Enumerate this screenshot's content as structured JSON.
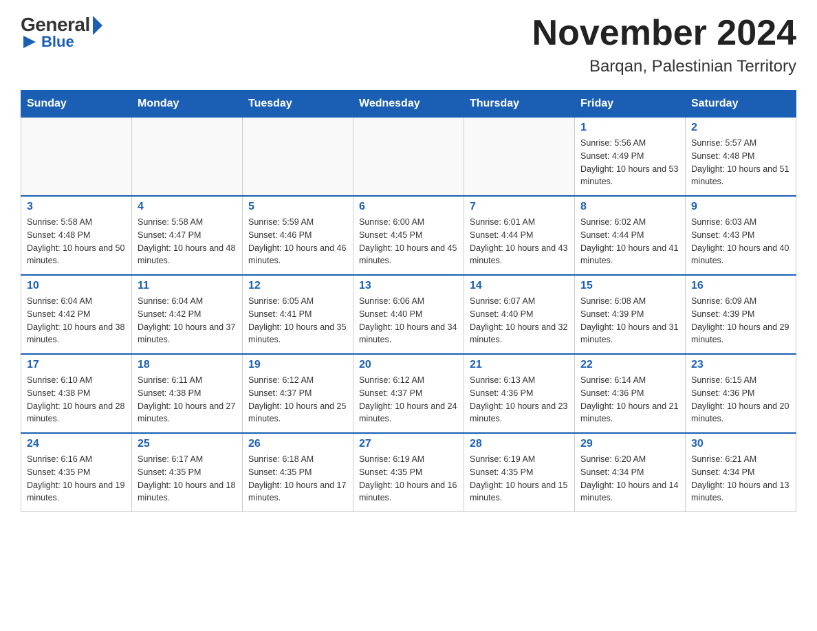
{
  "logo": {
    "general": "General",
    "blue": "Blue"
  },
  "header": {
    "month_year": "November 2024",
    "location": "Barqan, Palestinian Territory"
  },
  "weekdays": [
    "Sunday",
    "Monday",
    "Tuesday",
    "Wednesday",
    "Thursday",
    "Friday",
    "Saturday"
  ],
  "weeks": [
    [
      {
        "day": "",
        "info": ""
      },
      {
        "day": "",
        "info": ""
      },
      {
        "day": "",
        "info": ""
      },
      {
        "day": "",
        "info": ""
      },
      {
        "day": "",
        "info": ""
      },
      {
        "day": "1",
        "info": "Sunrise: 5:56 AM\nSunset: 4:49 PM\nDaylight: 10 hours and 53 minutes."
      },
      {
        "day": "2",
        "info": "Sunrise: 5:57 AM\nSunset: 4:48 PM\nDaylight: 10 hours and 51 minutes."
      }
    ],
    [
      {
        "day": "3",
        "info": "Sunrise: 5:58 AM\nSunset: 4:48 PM\nDaylight: 10 hours and 50 minutes."
      },
      {
        "day": "4",
        "info": "Sunrise: 5:58 AM\nSunset: 4:47 PM\nDaylight: 10 hours and 48 minutes."
      },
      {
        "day": "5",
        "info": "Sunrise: 5:59 AM\nSunset: 4:46 PM\nDaylight: 10 hours and 46 minutes."
      },
      {
        "day": "6",
        "info": "Sunrise: 6:00 AM\nSunset: 4:45 PM\nDaylight: 10 hours and 45 minutes."
      },
      {
        "day": "7",
        "info": "Sunrise: 6:01 AM\nSunset: 4:44 PM\nDaylight: 10 hours and 43 minutes."
      },
      {
        "day": "8",
        "info": "Sunrise: 6:02 AM\nSunset: 4:44 PM\nDaylight: 10 hours and 41 minutes."
      },
      {
        "day": "9",
        "info": "Sunrise: 6:03 AM\nSunset: 4:43 PM\nDaylight: 10 hours and 40 minutes."
      }
    ],
    [
      {
        "day": "10",
        "info": "Sunrise: 6:04 AM\nSunset: 4:42 PM\nDaylight: 10 hours and 38 minutes."
      },
      {
        "day": "11",
        "info": "Sunrise: 6:04 AM\nSunset: 4:42 PM\nDaylight: 10 hours and 37 minutes."
      },
      {
        "day": "12",
        "info": "Sunrise: 6:05 AM\nSunset: 4:41 PM\nDaylight: 10 hours and 35 minutes."
      },
      {
        "day": "13",
        "info": "Sunrise: 6:06 AM\nSunset: 4:40 PM\nDaylight: 10 hours and 34 minutes."
      },
      {
        "day": "14",
        "info": "Sunrise: 6:07 AM\nSunset: 4:40 PM\nDaylight: 10 hours and 32 minutes."
      },
      {
        "day": "15",
        "info": "Sunrise: 6:08 AM\nSunset: 4:39 PM\nDaylight: 10 hours and 31 minutes."
      },
      {
        "day": "16",
        "info": "Sunrise: 6:09 AM\nSunset: 4:39 PM\nDaylight: 10 hours and 29 minutes."
      }
    ],
    [
      {
        "day": "17",
        "info": "Sunrise: 6:10 AM\nSunset: 4:38 PM\nDaylight: 10 hours and 28 minutes."
      },
      {
        "day": "18",
        "info": "Sunrise: 6:11 AM\nSunset: 4:38 PM\nDaylight: 10 hours and 27 minutes."
      },
      {
        "day": "19",
        "info": "Sunrise: 6:12 AM\nSunset: 4:37 PM\nDaylight: 10 hours and 25 minutes."
      },
      {
        "day": "20",
        "info": "Sunrise: 6:12 AM\nSunset: 4:37 PM\nDaylight: 10 hours and 24 minutes."
      },
      {
        "day": "21",
        "info": "Sunrise: 6:13 AM\nSunset: 4:36 PM\nDaylight: 10 hours and 23 minutes."
      },
      {
        "day": "22",
        "info": "Sunrise: 6:14 AM\nSunset: 4:36 PM\nDaylight: 10 hours and 21 minutes."
      },
      {
        "day": "23",
        "info": "Sunrise: 6:15 AM\nSunset: 4:36 PM\nDaylight: 10 hours and 20 minutes."
      }
    ],
    [
      {
        "day": "24",
        "info": "Sunrise: 6:16 AM\nSunset: 4:35 PM\nDaylight: 10 hours and 19 minutes."
      },
      {
        "day": "25",
        "info": "Sunrise: 6:17 AM\nSunset: 4:35 PM\nDaylight: 10 hours and 18 minutes."
      },
      {
        "day": "26",
        "info": "Sunrise: 6:18 AM\nSunset: 4:35 PM\nDaylight: 10 hours and 17 minutes."
      },
      {
        "day": "27",
        "info": "Sunrise: 6:19 AM\nSunset: 4:35 PM\nDaylight: 10 hours and 16 minutes."
      },
      {
        "day": "28",
        "info": "Sunrise: 6:19 AM\nSunset: 4:35 PM\nDaylight: 10 hours and 15 minutes."
      },
      {
        "day": "29",
        "info": "Sunrise: 6:20 AM\nSunset: 4:34 PM\nDaylight: 10 hours and 14 minutes."
      },
      {
        "day": "30",
        "info": "Sunrise: 6:21 AM\nSunset: 4:34 PM\nDaylight: 10 hours and 13 minutes."
      }
    ]
  ]
}
